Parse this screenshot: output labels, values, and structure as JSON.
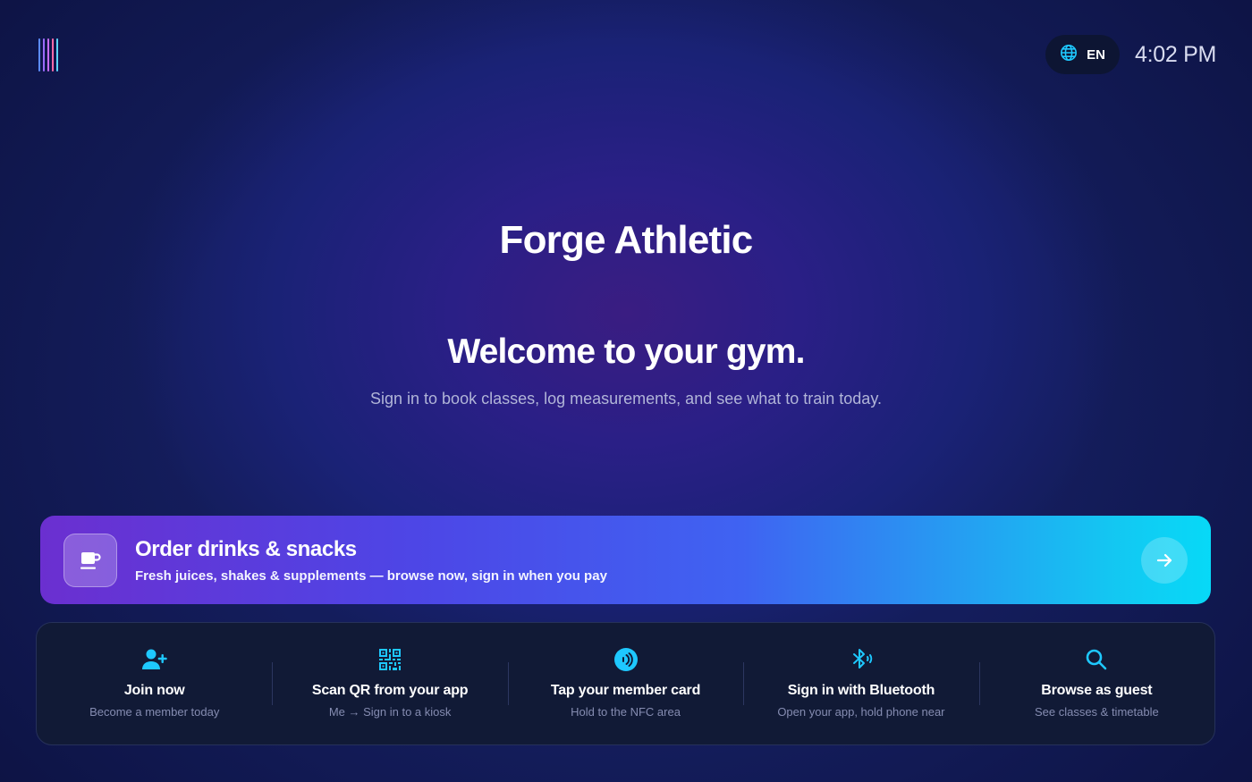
{
  "header": {
    "logo_colors": [
      "#5b8cff",
      "#9b6bff",
      "#c56cf0",
      "#ff6ba8",
      "#5cd6ff"
    ],
    "language_icon": "globe-icon",
    "language": "EN",
    "time": "4:02 PM"
  },
  "hero": {
    "brand": "Forge Athletic",
    "welcome": "Welcome to your gym.",
    "subtitle": "Sign in to book classes, log measurements, and see what to train today."
  },
  "order_banner": {
    "icon": "cup-icon",
    "title": "Order drinks & snacks",
    "subtitle": "Fresh juices, shakes & supplements — browse now, sign in when you pay",
    "arrow_icon": "arrow-right-icon"
  },
  "signin_options": [
    {
      "icon": "add-person-icon",
      "label": "Join now",
      "desc": "Become a member today"
    },
    {
      "icon": "qr-code-icon",
      "label": "Scan QR from your app",
      "desc": "Me → Sign in to a kiosk"
    },
    {
      "icon": "nfc-icon",
      "label": "Tap your member card",
      "desc": "Hold to the NFC area"
    },
    {
      "icon": "bluetooth-icon",
      "label": "Sign in with Bluetooth",
      "desc": "Open your app, hold phone near"
    },
    {
      "icon": "search-icon",
      "label": "Browse as guest",
      "desc": "See classes & timetable"
    }
  ],
  "colors": {
    "accent": "#1ec8ff",
    "panel": "#111a36"
  }
}
